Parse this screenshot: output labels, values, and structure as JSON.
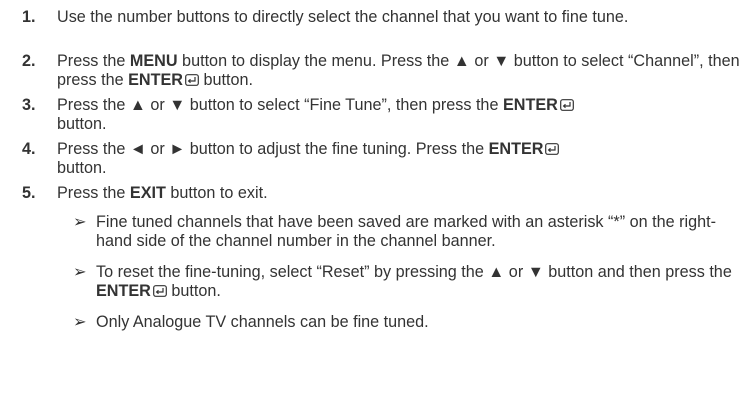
{
  "steps": [
    {
      "num": "1.",
      "text": "Use the number buttons to directly select the channel that you want to fine tune."
    },
    {
      "num": "2.",
      "t1": "Press the ",
      "b1": "MENU",
      "t2": " button to display the menu. Press the ▲ or ▼ button to select “Channel”, then press the ",
      "b2": "ENTER",
      "t3": " button."
    },
    {
      "num": "3.",
      "t1": "Press the ▲ or ▼ button to select “Fine Tune”, then press the ",
      "b1": "ENTER",
      "t2": " button."
    },
    {
      "num": "4.",
      "t1": "Press the ◄ or ► button to adjust the fine tuning. Press the ",
      "b1": "ENTER",
      "t2": " button."
    },
    {
      "num": "5.",
      "t1": "Press the ",
      "b1": "EXIT",
      "t2": " button to exit."
    }
  ],
  "notes": [
    {
      "arrow": "➢",
      "text": "Fine tuned channels that have been saved are marked with an asterisk “*” on the right-hand side of the channel number in the channel banner."
    },
    {
      "arrow": "➢",
      "t1": "To reset the fine-tuning, select “Reset” by pressing the ▲ or ▼ button and then press the ",
      "b1": "ENTER",
      "t2": " button."
    },
    {
      "arrow": "➢",
      "text": "Only Analogue TV channels can be fine tuned."
    }
  ],
  "icons": {
    "enter": "enter-icon"
  }
}
